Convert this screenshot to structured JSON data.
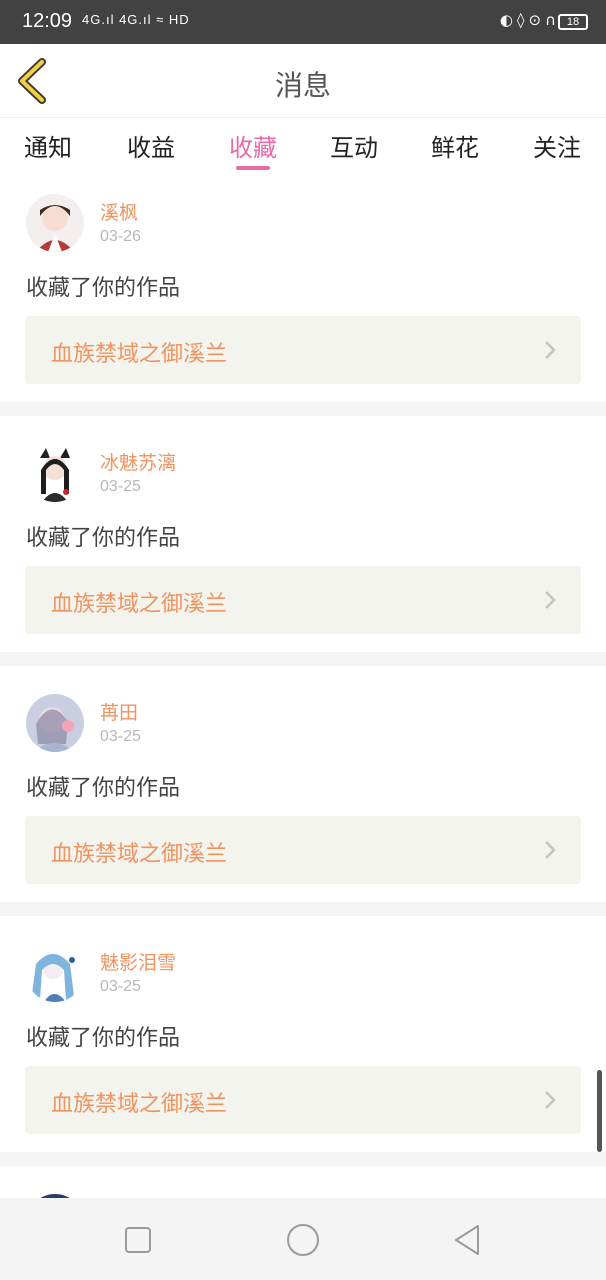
{
  "status_bar": {
    "time": "12:09",
    "left_icons": "4G.ıl 4G.ıl ≈ HD",
    "battery": "18"
  },
  "header": {
    "title": "消息"
  },
  "tabs": [
    {
      "label": "通知"
    },
    {
      "label": "收益"
    },
    {
      "label": "收藏",
      "active": true
    },
    {
      "label": "互动"
    },
    {
      "label": "鲜花"
    },
    {
      "label": "关注"
    }
  ],
  "colors": {
    "accent_pink": "#e86aa6",
    "name_orange": "#f0935f"
  },
  "messages": [
    {
      "username": "溪枫",
      "date": "03-26",
      "action": "收藏了你的作品",
      "work_title": "血族禁域之御溪兰"
    },
    {
      "username": "冰魅苏漓",
      "date": "03-25",
      "action": "收藏了你的作品",
      "work_title": "血族禁域之御溪兰"
    },
    {
      "username": "苒田",
      "date": "03-25",
      "action": "收藏了你的作品",
      "work_title": "血族禁域之御溪兰"
    },
    {
      "username": "魅影泪雪",
      "date": "03-25",
      "action": "收藏了你的作品",
      "work_title": "血族禁域之御溪兰"
    }
  ],
  "nav": {
    "icons": [
      "square-icon",
      "circle-icon",
      "triangle-back-icon"
    ]
  }
}
